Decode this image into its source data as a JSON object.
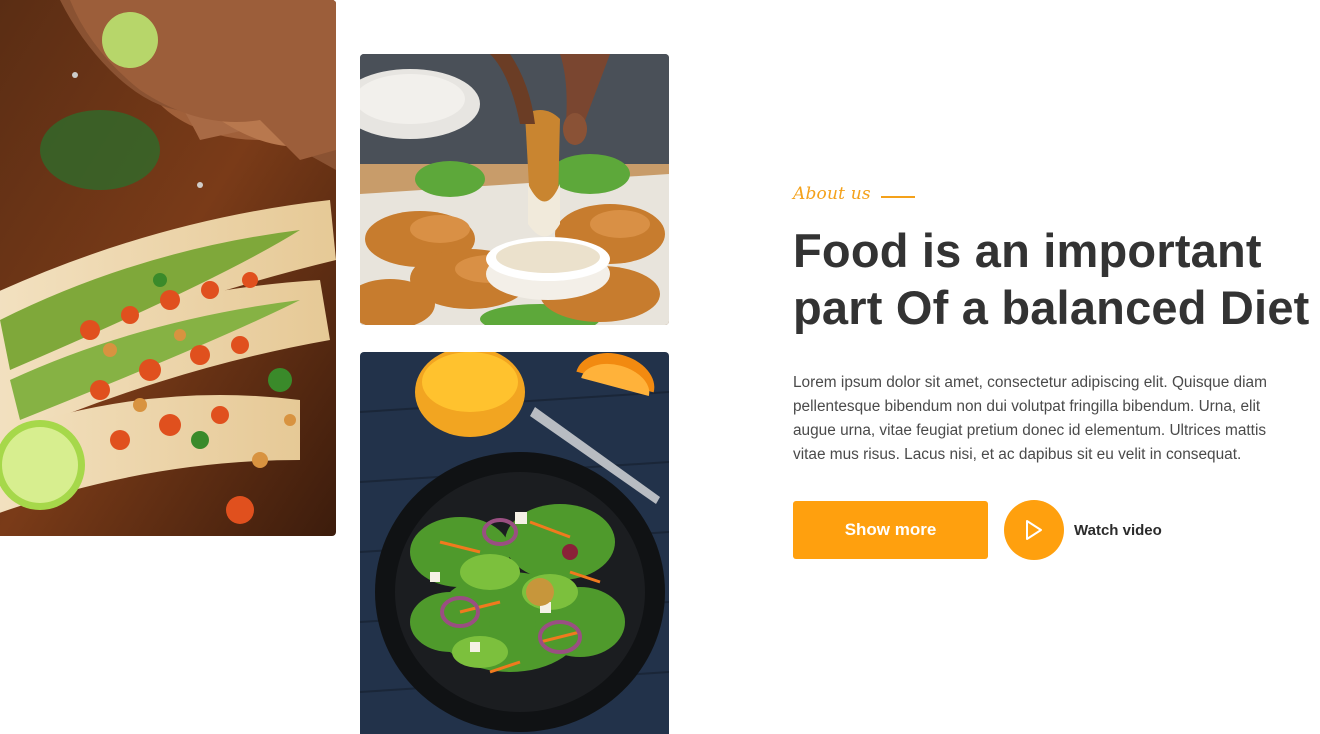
{
  "about": {
    "eyebrow": "About us",
    "headline_line1": "Food is an important",
    "headline_line2": "part Of a balanced Diet",
    "body": "Lorem ipsum dolor sit amet, consectetur adipiscing elit. Quisque diam pellentesque bibendum non dui volutpat fringilla bibendum. Urna, elit augue urna, vitae feugiat pretium donec id elementum. Ultrices mattis vitae mus risus. Lacus nisi, et ac dapibus sit eu velit in consequat."
  },
  "actions": {
    "show_more_label": "Show more",
    "watch_video_label": "Watch video",
    "play_icon": "play-icon"
  },
  "photos": {
    "tacos_alt": "Tacos with lime and vegetables",
    "chicken_alt": "Fried chicken strips with dip",
    "salad_alt": "Salad bowl with orange juice"
  },
  "colors": {
    "accent": "#ffa00e",
    "heading": "#333333",
    "body": "#4a4a4a"
  }
}
